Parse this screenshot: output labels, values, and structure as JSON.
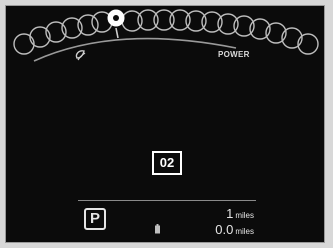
{
  "gauge": {
    "power_label": "POWER",
    "eco_icon": "eco-leaf-icon"
  },
  "display": {
    "message_code": "02"
  },
  "status": {
    "gear": "P",
    "battery_icon": "battery-icon",
    "trip": {
      "value": "1",
      "unit": "miles"
    },
    "range": {
      "value": "0.0",
      "unit": "miles"
    }
  },
  "colors": {
    "background": "#0b0b0b",
    "text": "#e5e5e5",
    "frame": "#d8d8d8"
  }
}
